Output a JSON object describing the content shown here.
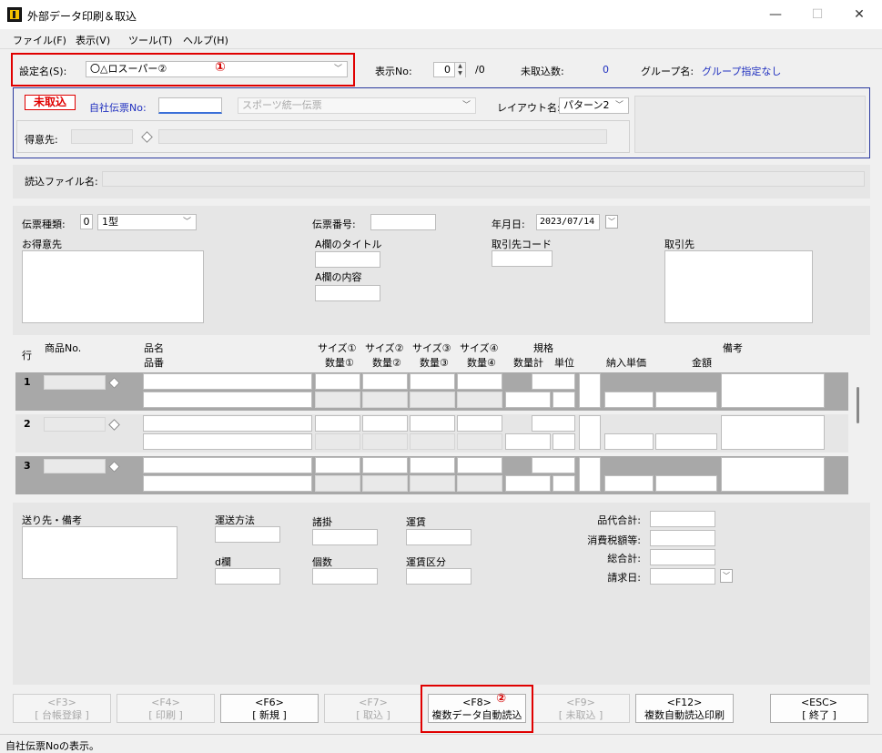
{
  "window": {
    "title": "外部データ印刷＆取込",
    "minimize": "—",
    "maximize": "☐",
    "close": "✕"
  },
  "menu": [
    "ファイル(F)",
    "表示(V)",
    "ツール(T)",
    "ヘルプ(H)"
  ],
  "settings": {
    "label": "設定名(S):",
    "value": "〇△ロスーパー②",
    "marker1": "①",
    "display_no_label": "表示No:",
    "display_no_value": "0",
    "display_no_total": "/0",
    "untaken_label": "未取込数:",
    "untaken_value": "0",
    "group_label": "グループ名:",
    "group_value": "グループ指定なし"
  },
  "status_box": {
    "badge": "未取込",
    "own_slip_label": "自社伝票No:",
    "slip_type": "スポーツ統一伝票",
    "layout_label": "レイアウト名:",
    "layout_value": "パターン2",
    "customer_label": "得意先:"
  },
  "read_file_label": "読込ファイル名:",
  "header": {
    "slip_kind_label": "伝票種類:",
    "slip_kind_code": "0",
    "slip_kind_value": "1型",
    "slip_no_label": "伝票番号:",
    "date_label": "年月日:",
    "date_value": "2023/07/14",
    "customer_label": "お得意先",
    "a_title_label": "A欄のタイトル",
    "a_content_label": "A欄の内容",
    "partner_code_label": "取引先コード",
    "partner_label": "取引先"
  },
  "grid": {
    "row_label": "行",
    "product_no": "商品No.",
    "name": "品名",
    "code": "品番",
    "sizes": [
      "サイズ①",
      "サイズ②",
      "サイズ③",
      "サイズ④"
    ],
    "qtys": [
      "数量①",
      "数量②",
      "数量③",
      "数量④"
    ],
    "spec": "規格",
    "qty_total": "数量計",
    "unit": "単位",
    "unit_price": "納入単価",
    "amount": "金額",
    "note": "備考",
    "rows": [
      "1",
      "2",
      "3"
    ]
  },
  "footer": {
    "dest_label": "送り先・備考",
    "transport_label": "運送方法",
    "d_label": "d欄",
    "misc_label": "諸掛",
    "count_label": "個数",
    "fare_label": "運賃",
    "fare_kind_label": "運賃区分",
    "subtotal_label": "品代合計:",
    "tax_label": "消費税額等:",
    "total_label": "総合計:",
    "bill_date_label": "請求日:"
  },
  "buttons": [
    {
      "key": "<F3>",
      "label": "[ 台帳登録 ]",
      "enabled": false
    },
    {
      "key": "<F4>",
      "label": "[ 印刷 ]",
      "enabled": false
    },
    {
      "key": "<F6>",
      "label": "[ 新規 ]",
      "enabled": true
    },
    {
      "key": "<F7>",
      "label": "[ 取込 ]",
      "enabled": false
    },
    {
      "key": "<F8>",
      "label": "複数データ自動読込",
      "enabled": true,
      "marker": "②"
    },
    {
      "key": "<F9>",
      "label": "[ 未取込 ]",
      "enabled": false
    },
    {
      "key": "<F12>",
      "label": "複数自動読込印刷",
      "enabled": true
    },
    {
      "key": "<ESC>",
      "label": "[ 終了 ]",
      "enabled": true
    }
  ],
  "status_text": "自社伝票Noの表示。",
  "colors": {
    "accent_blue": "#1f2fbf",
    "marker_red": "#e00000"
  }
}
